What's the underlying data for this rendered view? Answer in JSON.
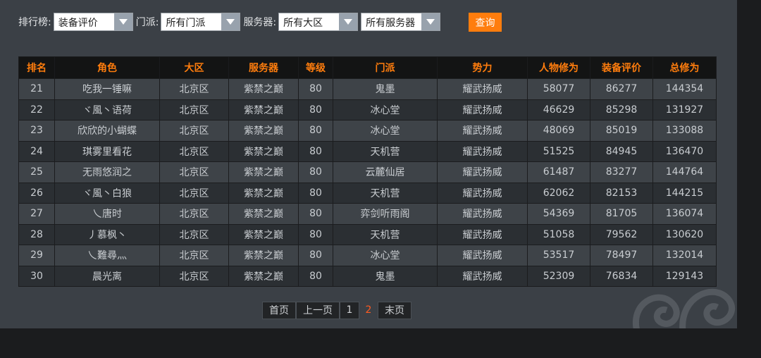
{
  "filters": {
    "rank_label": "排行榜:",
    "rank_value": "装备评价",
    "sect_label": "门派:",
    "sect_value": "所有门派",
    "server_label": "服务器:",
    "region_value": "所有大区",
    "server_value": "所有服务器",
    "query_label": "查询"
  },
  "table": {
    "headers": [
      "排名",
      "角色",
      "大区",
      "服务器",
      "等级",
      "门派",
      "势力",
      "人物修为",
      "装备评价",
      "总修为"
    ],
    "rows": [
      [
        "21",
        "吃我一锤嘛",
        "北京区",
        "紫禁之巅",
        "80",
        "鬼墨",
        "耀武扬威",
        "58077",
        "86277",
        "144354"
      ],
      [
        "22",
        "ヾ風丶语荷",
        "北京区",
        "紫禁之巅",
        "80",
        "冰心堂",
        "耀武扬威",
        "46629",
        "85298",
        "131927"
      ],
      [
        "23",
        "欣欣的小蝴蝶",
        "北京区",
        "紫禁之巅",
        "80",
        "冰心堂",
        "耀武扬威",
        "48069",
        "85019",
        "133088"
      ],
      [
        "24",
        "琪雾里看花",
        "北京区",
        "紫禁之巅",
        "80",
        "天机营",
        "耀武扬威",
        "51525",
        "84945",
        "136470"
      ],
      [
        "25",
        "无雨悠润之",
        "北京区",
        "紫禁之巅",
        "80",
        "云麓仙居",
        "耀武扬威",
        "61487",
        "83277",
        "144764"
      ],
      [
        "26",
        "ヾ風丶白狼",
        "北京区",
        "紫禁之巅",
        "80",
        "天机营",
        "耀武扬威",
        "62062",
        "82153",
        "144215"
      ],
      [
        "27",
        "乀唐时",
        "北京区",
        "紫禁之巅",
        "80",
        "弈剑听雨阁",
        "耀武扬威",
        "54369",
        "81705",
        "136074"
      ],
      [
        "28",
        "丿慕枫丶",
        "北京区",
        "紫禁之巅",
        "80",
        "天机营",
        "耀武扬威",
        "51058",
        "79562",
        "130620"
      ],
      [
        "29",
        "乀難尋灬",
        "北京区",
        "紫禁之巅",
        "80",
        "冰心堂",
        "耀武扬威",
        "53517",
        "78497",
        "132014"
      ],
      [
        "30",
        "晨光离",
        "北京区",
        "紫禁之巅",
        "80",
        "鬼墨",
        "耀武扬威",
        "52309",
        "76834",
        "129143"
      ]
    ]
  },
  "pager": {
    "first": "首页",
    "prev": "上一页",
    "page1": "1",
    "page2": "2",
    "last": "末页"
  },
  "colors": {
    "accent": "#ff7d0d",
    "current_page": "#ff5a20",
    "panel_bg": "#3b4046"
  },
  "icons": {
    "dropdown": "chevron-down-icon",
    "decoration": "cloud-swirl-icon"
  }
}
